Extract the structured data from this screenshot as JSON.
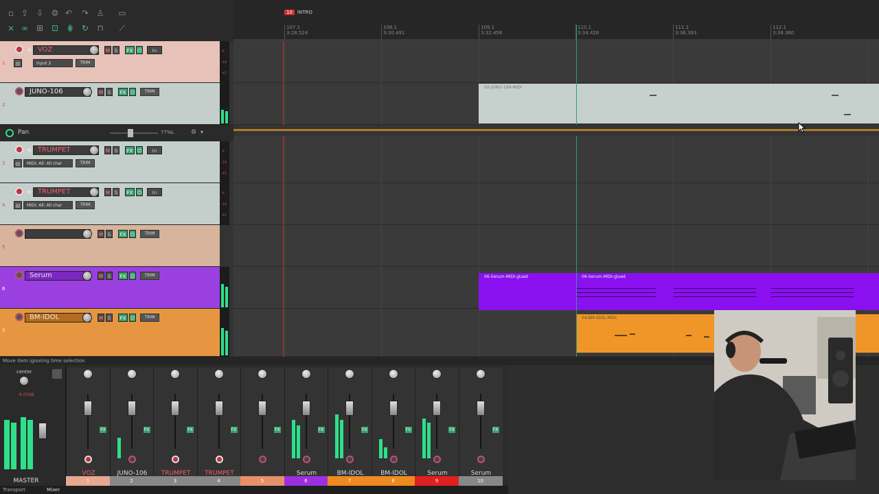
{
  "ruler": {
    "region_number": "10",
    "region_name": "INTRO",
    "bars": [
      {
        "bar": "107.1",
        "time": "3:28.524"
      },
      {
        "bar": "108.1",
        "time": "3:30.491"
      },
      {
        "bar": "109.1",
        "time": "3:32.458"
      },
      {
        "bar": "110.1",
        "time": "3:34.426"
      },
      {
        "bar": "111.1",
        "time": "3:36.393"
      },
      {
        "bar": "112.1",
        "time": "3:38.360"
      }
    ]
  },
  "tracks": [
    {
      "num": "1",
      "name": "VOZ",
      "input": "Input 2",
      "color": "#e6c2b8"
    },
    {
      "num": "2",
      "name": "JUNO-106",
      "color": "#c4cfcc"
    },
    {
      "num": "3",
      "name": "TRUMPET",
      "input": "MIDI: All: All char",
      "color": "#c4cfcc"
    },
    {
      "num": "4",
      "name": "TRUMPET",
      "input": "MIDI: All: All char",
      "color": "#c4cfcc"
    },
    {
      "num": "5",
      "name": "",
      "color": "#d8b49c"
    },
    {
      "num": "6",
      "name": "Serum",
      "color": "#9a40e0"
    },
    {
      "num": "7",
      "name": "BM-IDOL",
      "color": "#e69640"
    }
  ],
  "envelope": {
    "label": "Pan",
    "value": "77%L"
  },
  "button_labels": {
    "mute": "M",
    "solo": "S",
    "fx": "FX",
    "io": "in",
    "trim": "TRIM"
  },
  "items": {
    "juno": "02-JUNO-106-MIDI",
    "serum_a": "06-Serum-MIDI-glued",
    "serum_b": "06-Serum-MIDI-glued",
    "bm_idol": "04-BM-IDOL-MIDI"
  },
  "status": "Move item ignoring time selection",
  "mixer": {
    "master": {
      "label": "MASTER",
      "pan": "center",
      "db": "-6.00dB"
    },
    "strips": [
      {
        "name": "VOZ",
        "num": "1",
        "color": "#e6a890",
        "red": true
      },
      {
        "name": "JUNO-106",
        "num": "2",
        "color": "#888888",
        "red": false
      },
      {
        "name": "TRUMPET",
        "num": "3",
        "color": "#888888",
        "red": true
      },
      {
        "name": "TRUMPET",
        "num": "4",
        "color": "#888888",
        "red": true
      },
      {
        "name": "",
        "num": "5",
        "color": "#e6906a",
        "red": false
      },
      {
        "name": "Serum",
        "num": "6",
        "color": "#9a30e0",
        "red": false
      },
      {
        "name": "BM-IDOL",
        "num": "7",
        "color": "#ee8a20",
        "red": false
      },
      {
        "name": "BM-IDOL",
        "num": "8",
        "color": "#ee8a20",
        "red": false
      },
      {
        "name": "Serum",
        "num": "9",
        "color": "#e02020",
        "red": false
      },
      {
        "name": "Serum",
        "num": "10",
        "color": "#888888",
        "red": false
      }
    ],
    "tabs": [
      "Transport",
      "Mixer"
    ]
  }
}
